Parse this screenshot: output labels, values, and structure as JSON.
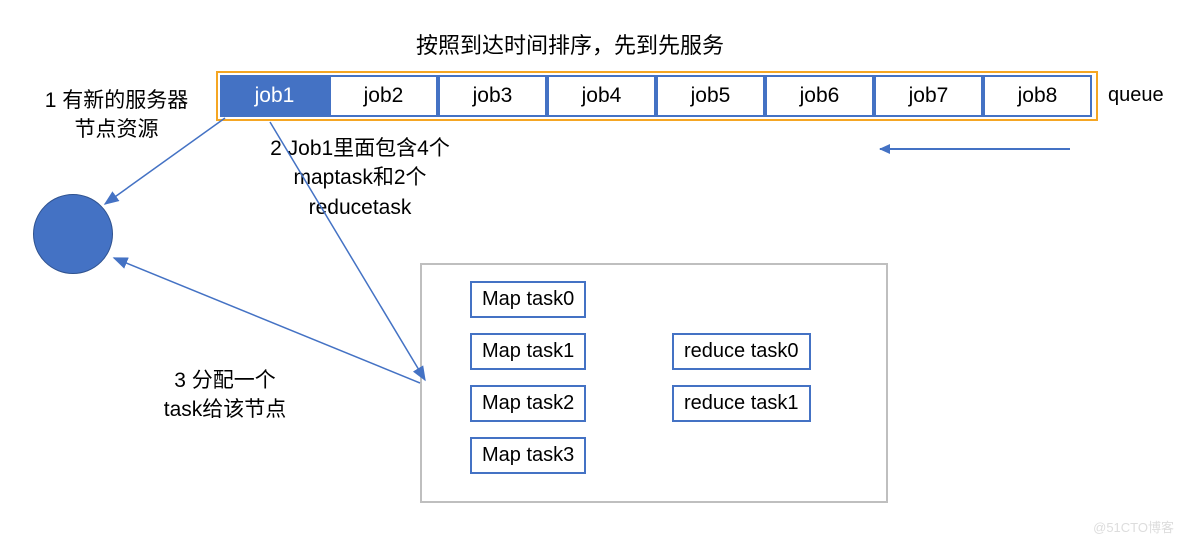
{
  "title": "按照到达时间排序，先到先服务",
  "queueLabel": "queue",
  "jobs": [
    "job1",
    "job2",
    "job3",
    "job4",
    "job5",
    "job6",
    "job7",
    "job8"
  ],
  "note1": {
    "line1": "1 有新的服务器",
    "line2": "节点资源"
  },
  "note2": {
    "line1": "2 Job1里面包含4个",
    "line2": "maptask和2个",
    "line3": "reducetask"
  },
  "note3": {
    "line1": "3 分配一个",
    "line2": "task给该节点"
  },
  "tasks": {
    "mt0": "Map task0",
    "mt1": "Map task1",
    "mt2": "Map task2",
    "mt3": "Map task3",
    "rt0": "reduce task0",
    "rt1": "reduce task1"
  },
  "watermark": "@51CTO博客"
}
